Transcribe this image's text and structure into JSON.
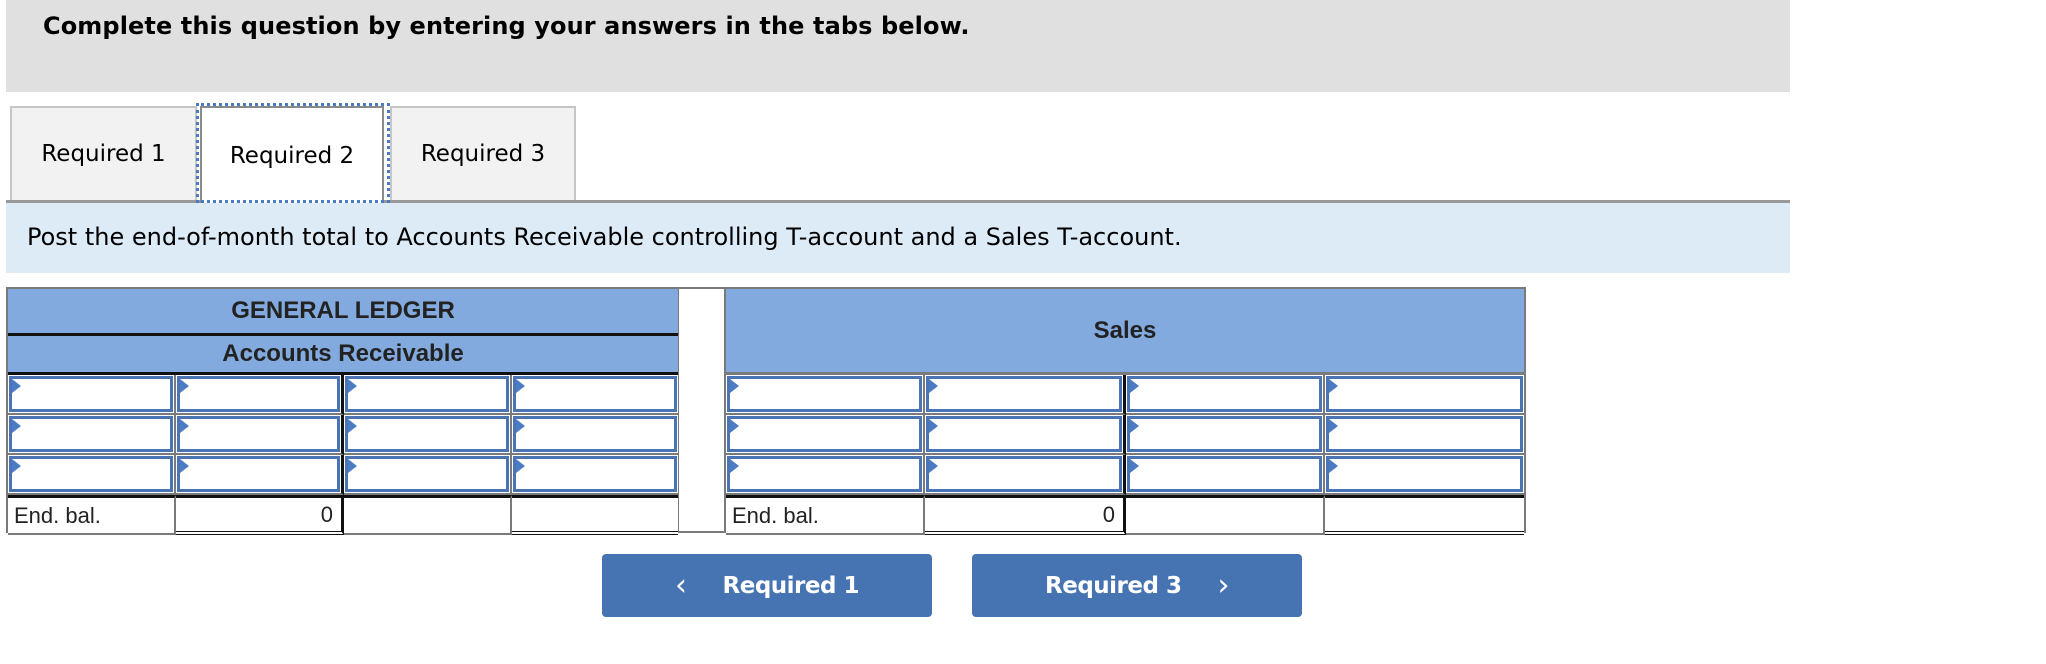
{
  "banner": {
    "text": "Complete this question by entering your answers in the tabs below."
  },
  "tabs": [
    {
      "label": "Required 1",
      "active": false
    },
    {
      "label": "Required 2",
      "active": true
    },
    {
      "label": "Required 3",
      "active": false
    }
  ],
  "instruction": "Post the end-of-month total to Accounts Receivable controlling T-account and a Sales T-account.",
  "accounts_receivable": {
    "header_1": "GENERAL LEDGER",
    "header_2": "Accounts Receivable",
    "rows": [
      [
        "",
        "",
        "",
        ""
      ],
      [
        "",
        "",
        "",
        ""
      ],
      [
        "",
        "",
        "",
        ""
      ]
    ],
    "end_balance": {
      "label": "End. bal.",
      "debit_value": "0",
      "credit_label": "",
      "credit_value": ""
    }
  },
  "sales": {
    "header": "Sales",
    "rows": [
      [
        "",
        "",
        "",
        ""
      ],
      [
        "",
        "",
        "",
        ""
      ],
      [
        "",
        "",
        "",
        ""
      ]
    ],
    "end_balance": {
      "label": "End. bal.",
      "debit_value": "0",
      "credit_label": "",
      "credit_value": ""
    }
  },
  "navigation": {
    "prev_label": "Required 1",
    "prev_icon": "chevron-left-icon",
    "next_label": "Required 3",
    "next_icon": "chevron-right-icon"
  },
  "colors": {
    "header_blue": "#82aade",
    "button_blue": "#4674b2",
    "instruction_band": "#ddebf7",
    "banner_gray": "#e0e0e0",
    "input_border": "#4a74b3"
  }
}
